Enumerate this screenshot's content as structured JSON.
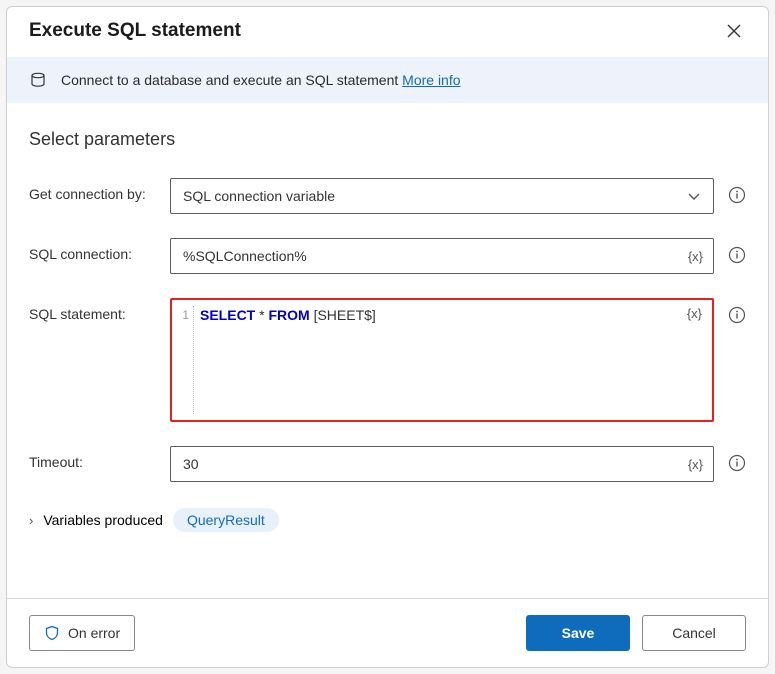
{
  "dialog": {
    "title": "Execute SQL statement"
  },
  "info": {
    "text": "Connect to a database and execute an SQL statement ",
    "link": "More info"
  },
  "section": {
    "heading": "Select parameters"
  },
  "fields": {
    "getConnectionBy": {
      "label": "Get connection by:",
      "value": "SQL connection variable"
    },
    "sqlConnection": {
      "label": "SQL connection:",
      "value": "%SQLConnection%"
    },
    "sqlStatement": {
      "label": "SQL statement:",
      "lineNumber": "1",
      "kw1": "SELECT",
      "star": " * ",
      "kw2": "FROM",
      "rest": " [SHEET$]"
    },
    "timeout": {
      "label": "Timeout:",
      "value": "30"
    }
  },
  "variables": {
    "chevron": "›",
    "label": "Variables produced",
    "chip": "QueryResult"
  },
  "varToken": "{x}",
  "footer": {
    "onError": "On error",
    "save": "Save",
    "cancel": "Cancel"
  }
}
